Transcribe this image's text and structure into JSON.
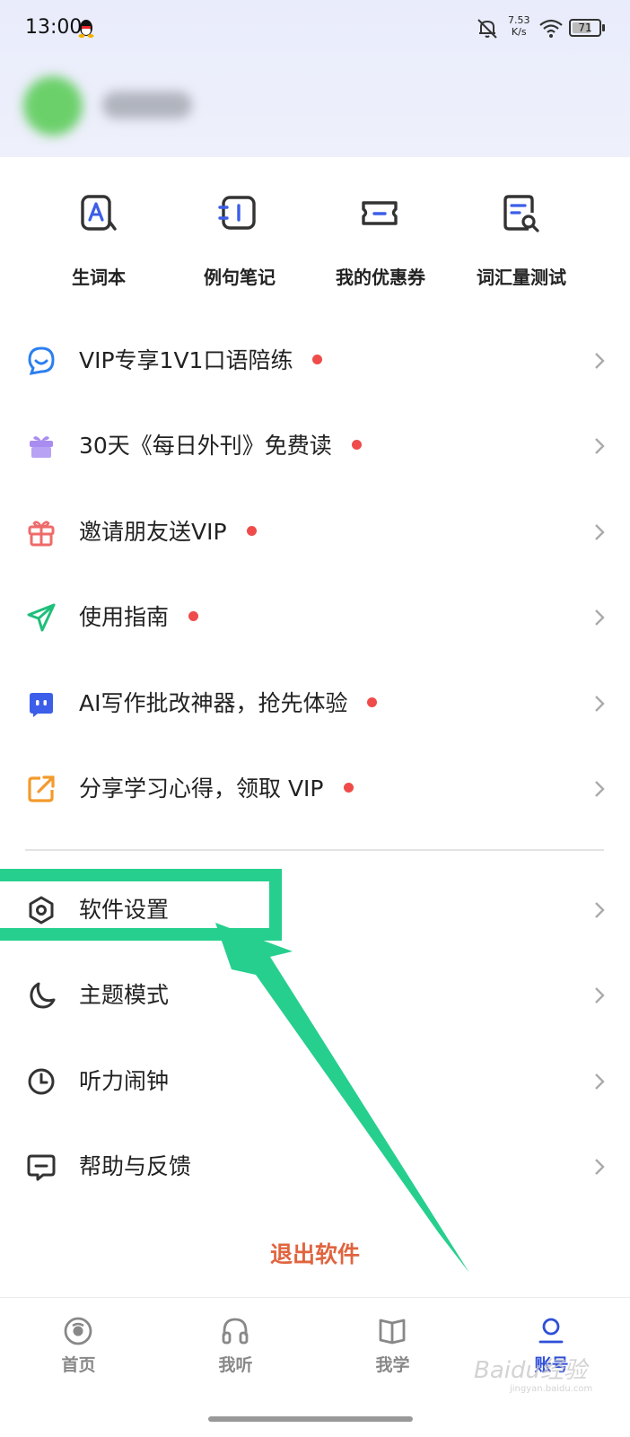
{
  "status_bar": {
    "time": "13:00",
    "net_speed_value": "7.53",
    "net_speed_unit": "K/s",
    "battery": "71",
    "battery_level": 0.71
  },
  "quick_actions": [
    {
      "label": "生词本",
      "icon": "vocabulary-book-icon"
    },
    {
      "label": "例句笔记",
      "icon": "sentence-notes-icon"
    },
    {
      "label": "我的优惠券",
      "icon": "coupon-icon"
    },
    {
      "label": "词汇量测试",
      "icon": "vocabulary-test-icon"
    }
  ],
  "promo_items": [
    {
      "label": "VIP专享1V1口语陪练",
      "icon": "chat-bubble-icon",
      "color": "#2b7ff0"
    },
    {
      "label": "30天《每日外刊》免费读",
      "icon": "gift-box-icon",
      "color": "#a98cf0"
    },
    {
      "label": "邀请朋友送VIP",
      "icon": "gift-icon",
      "color": "#ef6a6a"
    },
    {
      "label": "使用指南",
      "icon": "paper-plane-icon",
      "color": "#1fbf7a"
    },
    {
      "label": "AI写作批改神器，抢先体验",
      "icon": "robot-icon",
      "color": "#3c5ee8"
    },
    {
      "label": "分享学习心得，领取 VIP",
      "icon": "share-icon",
      "color": "#f39a2b"
    }
  ],
  "settings_items": [
    {
      "label": "软件设置",
      "icon": "settings-icon"
    },
    {
      "label": "主题模式",
      "icon": "moon-icon"
    },
    {
      "label": "听力闹钟",
      "icon": "clock-icon"
    },
    {
      "label": "帮助与反馈",
      "icon": "feedback-icon"
    }
  ],
  "logout_label": "退出软件",
  "bottom_nav": [
    {
      "label": "首页",
      "icon": "home-icon",
      "active": false
    },
    {
      "label": "我听",
      "icon": "headphones-icon",
      "active": false
    },
    {
      "label": "我学",
      "icon": "book-icon",
      "active": false
    },
    {
      "label": "账号",
      "icon": "account-icon",
      "active": true
    }
  ],
  "colors": {
    "accent": "#2f4fd8",
    "red_dot": "#ef4b4b",
    "highlight_annotation": "#26cf8d",
    "logout": "#e0643f"
  },
  "watermark": {
    "text": "Baidu经验",
    "sub": "jingyan.baidu.com"
  }
}
